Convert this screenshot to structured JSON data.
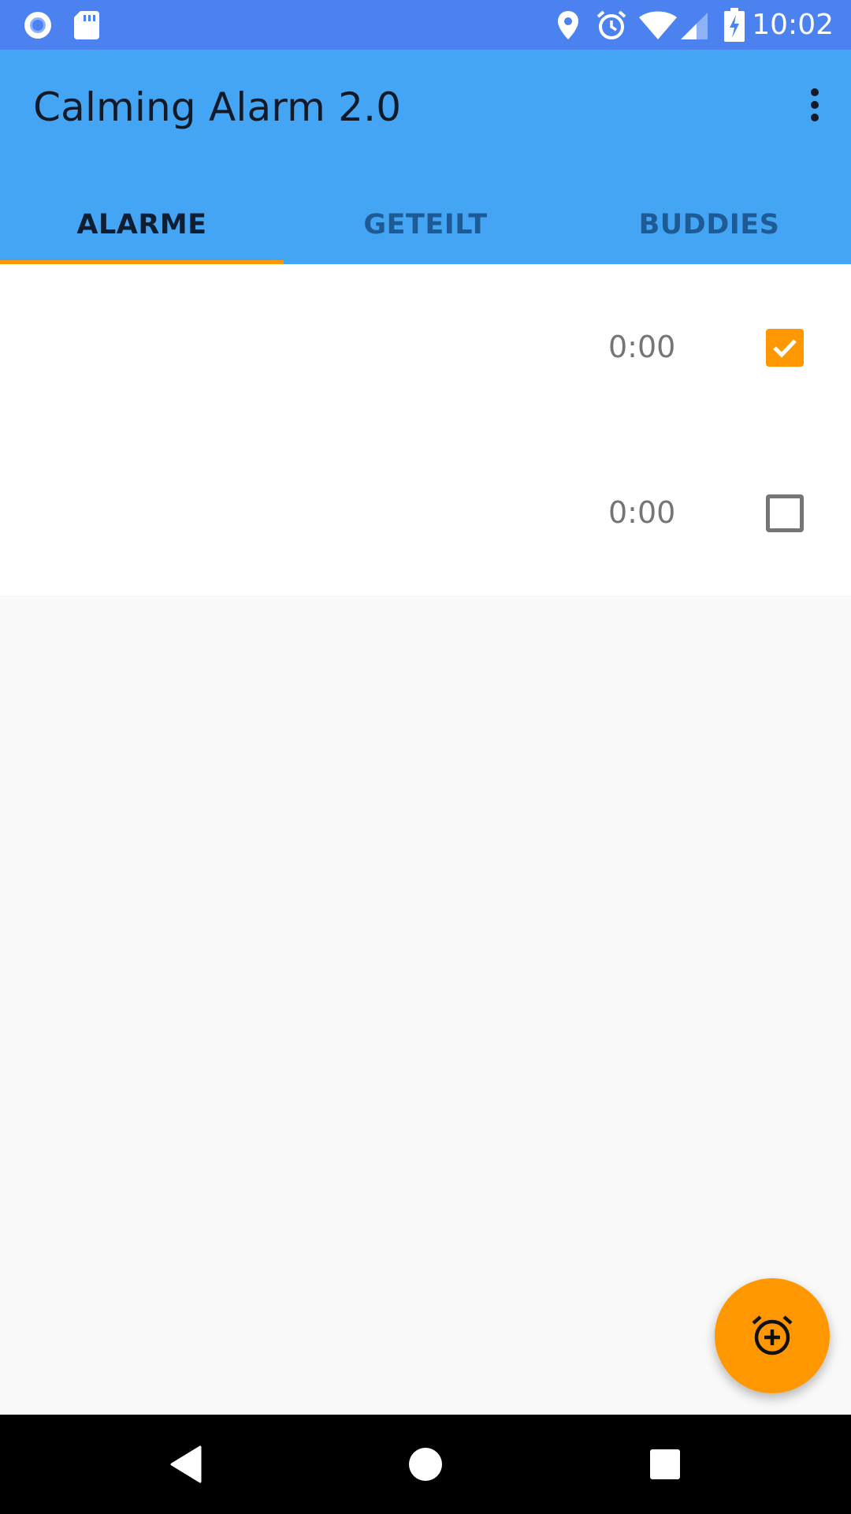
{
  "status_bar": {
    "time": "10:02",
    "icons": [
      "record-icon",
      "sd-card-icon",
      "location-icon",
      "alarm-icon",
      "wifi-icon",
      "signal-icon",
      "battery-charging-icon"
    ]
  },
  "app_bar": {
    "title": "Calming Alarm 2.0",
    "overflow_icon": "more-vertical-icon"
  },
  "tabs": [
    {
      "label": "ALARME",
      "active": true
    },
    {
      "label": "GETEILT",
      "active": false
    },
    {
      "label": "BUDDIES",
      "active": false
    }
  ],
  "alarms": [
    {
      "time": "0:00",
      "enabled": true
    },
    {
      "time": "0:00",
      "enabled": false
    }
  ],
  "fab": {
    "icon": "add-alarm-icon"
  },
  "nav_bar": {
    "icons": [
      "back-icon",
      "home-icon",
      "recents-icon"
    ]
  },
  "colors": {
    "status_bar": "#4b82f0",
    "app_bar": "#45a5f5",
    "accent": "#ff9800",
    "background": "#f9f9f9"
  }
}
